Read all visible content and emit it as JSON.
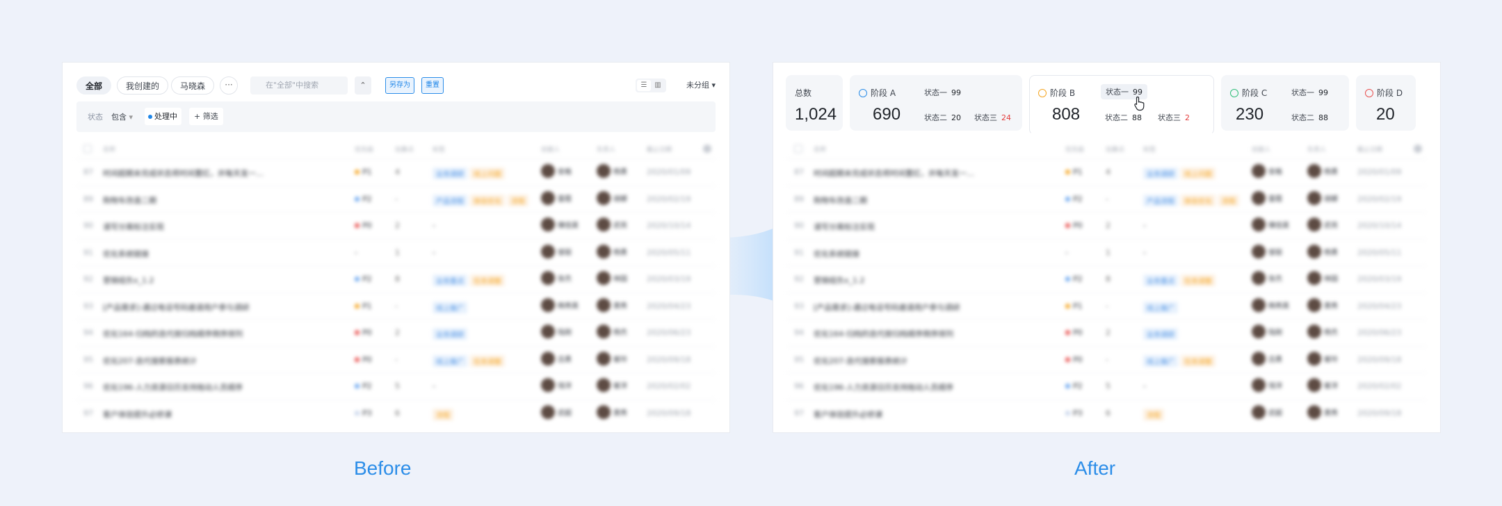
{
  "captions": {
    "before": "Before",
    "after": "After"
  },
  "toolbar": {
    "chips": [
      "全部",
      "我创建的",
      "马晓森"
    ],
    "more": "···",
    "search_placeholder": "在\"全部\"中搜索",
    "collapse": "⌃",
    "save_as": "另存为",
    "reset": "重置",
    "group": "未分组"
  },
  "filter": {
    "field": "状态",
    "op": "包含",
    "value": "处理中",
    "add": "筛选"
  },
  "table": {
    "headers": [
      "名称",
      "优先级",
      "估算点",
      "标签",
      "创建人",
      "负责人",
      "截止日期"
    ],
    "rows": [
      {
        "id": "87",
        "name": "时间超期未完成状态将时间置红，并每天发一…",
        "pri": "P1",
        "pri_color": "#f5a623",
        "est": "4",
        "tags": [
          [
            "业务调研",
            "#e7f1fd",
            "#4a90e2"
          ],
          [
            "线上问题",
            "#fdf1e3",
            "#f5a623"
          ]
        ],
        "c1": "安格",
        "c2": "杨勇",
        "date": "2020/01/09"
      },
      {
        "id": "89",
        "name": "购物车改造二期",
        "pri": "P2",
        "pri_color": "#6aa6ee",
        "est": "-",
        "tags": [
          [
            "产品流程",
            "#e7f1fd",
            "#4a90e2"
          ],
          [
            "体验优化",
            "#fdf1e3",
            "#f5a623"
          ],
          [
            "流程",
            "#fdf1e3",
            "#f5a623"
          ]
        ],
        "c1": "雷霞",
        "c2": "胡娜",
        "date": "2020/02/19"
      },
      {
        "id": "90",
        "name": "请写分离标注实现",
        "pri": "P0",
        "pri_color": "#e8504f",
        "est": "2",
        "tags": [],
        "tags_text": "-",
        "c1": "臻佳昊",
        "c2": "武亮",
        "date": "2020/10/14"
      },
      {
        "id": "91",
        "name": "优化系统链接",
        "pri": "-",
        "pri_color": "",
        "est": "1",
        "tags": [],
        "tags_text": "-",
        "c1": "邹丽",
        "c2": "杨勇",
        "date": "2020/05/11"
      },
      {
        "id": "92",
        "name": "营销组负x_1.2",
        "pri": "P2",
        "pri_color": "#6aa6ee",
        "est": "8",
        "tags": [
          [
            "业务重点",
            "#e7f1fd",
            "#4a90e2"
          ],
          [
            "任务调整",
            "#fdf1e3",
            "#f5a623"
          ]
        ],
        "c1": "张杰",
        "c2": "林园",
        "date": "2020/03/19"
      },
      {
        "id": "93",
        "name": "[产品需求]-通过电话号码邀请用户参与调研",
        "pri": "P1",
        "pri_color": "#f5a623",
        "est": "-",
        "tags": [
          [
            "线上推广",
            "#e7f1fd",
            "#4a90e2"
          ]
        ],
        "c1": "韩秀英",
        "c2": "黄秀",
        "date": "2020/04/23"
      },
      {
        "id": "94",
        "name": "优化164-归档的迭代按归档顺序倒序排列",
        "pri": "P0",
        "pri_color": "#e8504f",
        "est": "2",
        "tags": [
          [
            "业务调研",
            "#e7f1fd",
            "#4a90e2"
          ]
        ],
        "c1": "陆刚",
        "c2": "杨杰",
        "date": "2020/06/23"
      },
      {
        "id": "95",
        "name": "优化207-迭代搜索报表统计",
        "pri": "P0",
        "pri_color": "#e8504f",
        "est": "-",
        "tags": [
          [
            "线上推广",
            "#e7f1fd",
            "#4a90e2"
          ],
          [
            "任务调整",
            "#fdf1e3",
            "#f5a623"
          ]
        ],
        "c1": "吕勇",
        "c2": "崔玲",
        "date": "2020/09/18"
      },
      {
        "id": "96",
        "name": "优化196-人力资源日历支持拖动人员顺序",
        "pri": "P2",
        "pri_color": "#6aa6ee",
        "est": "5",
        "tags": [],
        "tags_text": "-",
        "c1": "钱洋",
        "c2": "崔洋",
        "date": "2020/02/02"
      },
      {
        "id": "97",
        "name": "客户体验提升必修课",
        "pri": "P3",
        "pri_color": "#c5d3ea",
        "est": "6",
        "tags": [
          [
            "流程",
            "#fdf1e3",
            "#f5a623"
          ]
        ],
        "c1": "武超",
        "c2": "黄秀",
        "date": "2020/09/18"
      }
    ]
  },
  "stats": {
    "total": {
      "label": "总数",
      "value": "1,024"
    },
    "stages": [
      {
        "label": "阶段 A",
        "value": "690",
        "color": "#2b8de8",
        "subs": [
          [
            "状态一",
            "99",
            false
          ],
          [
            "状态二",
            "20",
            false
          ],
          [
            "状态三",
            "24",
            true
          ]
        ]
      },
      {
        "label": "阶段 B",
        "value": "808",
        "color": "#f5a623",
        "subs": [
          [
            "状态一",
            "99",
            false
          ],
          [
            "状态二",
            "88",
            false
          ],
          [
            "状态三",
            "2",
            true
          ]
        ]
      },
      {
        "label": "阶段 C",
        "value": "230",
        "color": "#2dbd78",
        "subs": [
          [
            "状态一",
            "99",
            false
          ],
          [
            "状态二",
            "88",
            false
          ]
        ]
      },
      {
        "label": "阶段 D",
        "value": "20",
        "color": "#e8504f",
        "subs": []
      }
    ]
  }
}
